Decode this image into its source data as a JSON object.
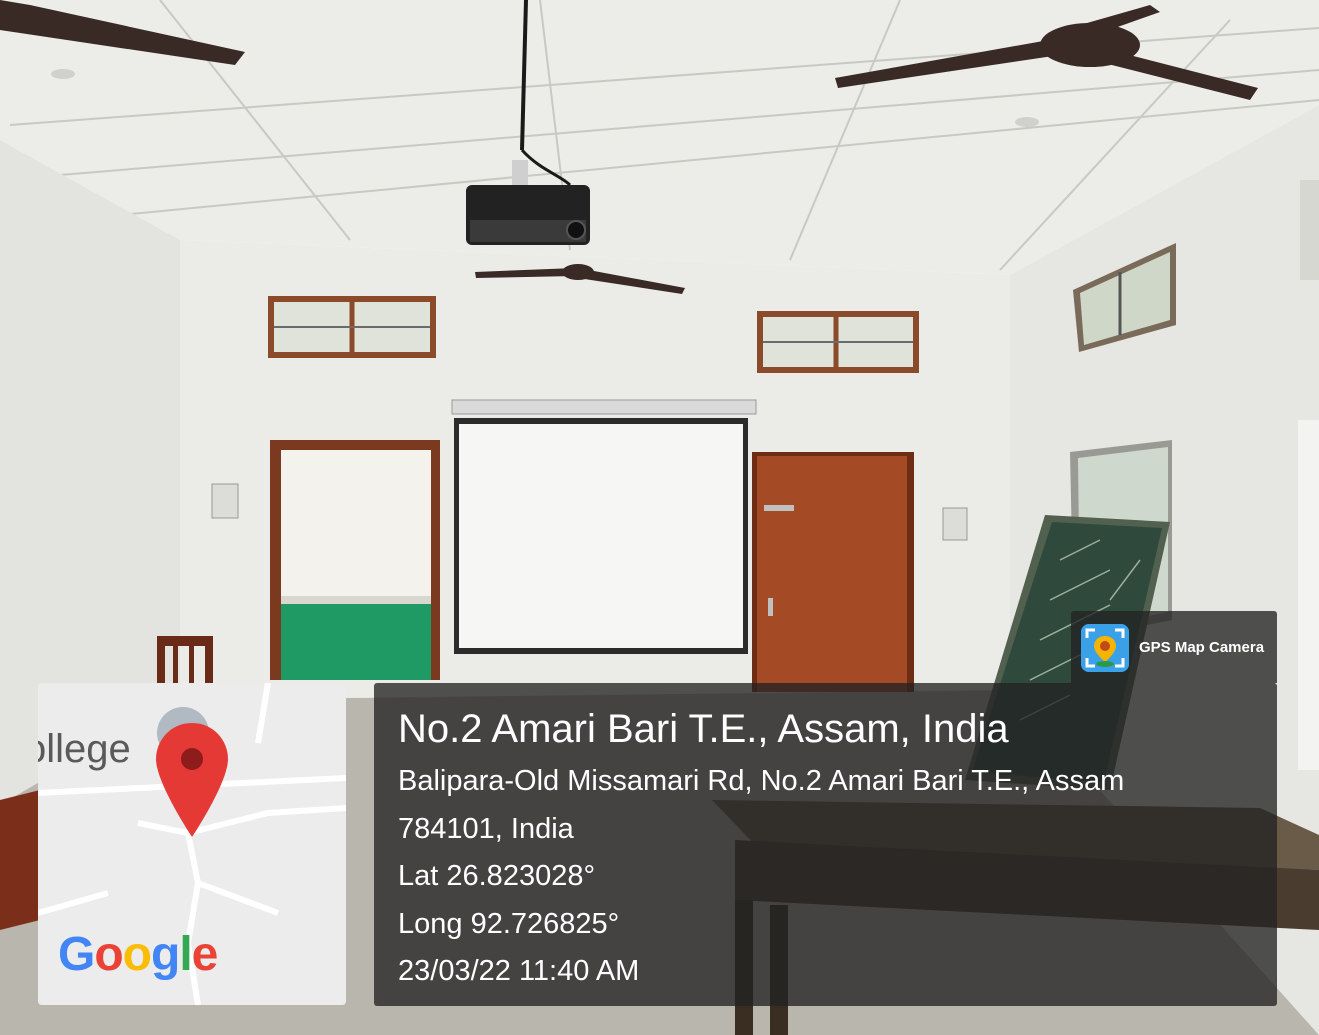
{
  "map": {
    "place_label": "ollege",
    "logo_text": "Google",
    "logo_letters": [
      "G",
      "o",
      "o",
      "g",
      "l",
      "e"
    ],
    "logo_colors": [
      "#4285F4",
      "#EA4335",
      "#FBBC05",
      "#4285F4",
      "#34A853",
      "#EA4335"
    ],
    "pin_color": "#E53935"
  },
  "app_badge": {
    "label": "GPS Map Camera",
    "icon": "gps-map-camera-icon"
  },
  "location": {
    "title": "No.2 Amari Bari T.E., Assam, India",
    "address_line1": "Balipara-Old Missamari Rd, No.2 Amari Bari T.E., Assam",
    "address_line2": "784101, India",
    "latitude": "Lat 26.823028°",
    "longitude": "Long 92.726825°",
    "datetime": "23/03/22 11:40 AM"
  },
  "colors": {
    "panel_bg": "rgba(35,35,35,0.78)",
    "wall": "#e9e9e7",
    "ceiling": "#efefec",
    "door_wood": "#8b3a1f",
    "chalkboard": "#2f4a3c"
  }
}
